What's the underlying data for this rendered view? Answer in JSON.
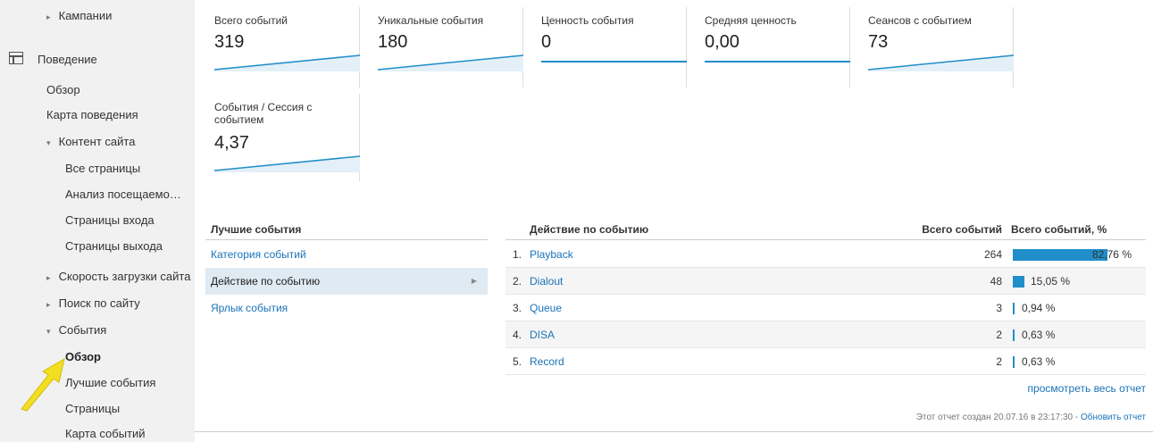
{
  "sidebar": {
    "campaigns": "Кампании",
    "behavior": "Поведение",
    "overview": "Обзор",
    "behavior_flow": "Карта поведения",
    "site_content": "Контент сайта",
    "all_pages": "Все страницы",
    "content_drilldown": "Анализ посещаемо…",
    "landing_pages": "Страницы входа",
    "exit_pages": "Страницы выхода",
    "site_speed": "Скорость загрузки сайта",
    "site_search": "Поиск по сайту",
    "events": "События",
    "events_overview": "Обзор",
    "top_events": "Лучшие события",
    "pages": "Страницы",
    "events_flow": "Карта событий"
  },
  "metrics": [
    {
      "label": "Всего событий",
      "value": "319"
    },
    {
      "label": "Уникальные события",
      "value": "180"
    },
    {
      "label": "Ценность события",
      "value": "0"
    },
    {
      "label": "Средняя ценность",
      "value": "0,00"
    },
    {
      "label": "Сеансов с событием",
      "value": "73"
    },
    {
      "label": "События / Сессия с событием",
      "value": "4,37"
    }
  ],
  "best_events": {
    "header": "Лучшие события",
    "items": [
      "Категория событий",
      "Действие по событию",
      "Ярлык события"
    ],
    "selected_index": 1
  },
  "actions": {
    "col_action": "Действие по событию",
    "col_total": "Всего событий",
    "col_pct": "Всего событий, %",
    "rows": [
      {
        "num": "1.",
        "name": "Playback",
        "total": "264",
        "pct": "82,76 %",
        "share": 0.8276
      },
      {
        "num": "2.",
        "name": "Dialout",
        "total": "48",
        "pct": "15,05 %",
        "share": 0.1505
      },
      {
        "num": "3.",
        "name": "Queue",
        "total": "3",
        "pct": "0,94 %",
        "share": 0.0094
      },
      {
        "num": "4.",
        "name": "DISA",
        "total": "2",
        "pct": "0,63 %",
        "share": 0.0063
      },
      {
        "num": "5.",
        "name": "Record",
        "total": "2",
        "pct": "0,63 %",
        "share": 0.0063
      }
    ]
  },
  "footer": {
    "view_all": "просмотреть весь отчет",
    "created": "Этот отчет создан 20.07.16 в 23:17:30 - ",
    "refresh": "Обновить отчет"
  },
  "colors": {
    "accent": "#1f8ec9",
    "link": "#1a73b8",
    "arrow": "#f2e020"
  }
}
